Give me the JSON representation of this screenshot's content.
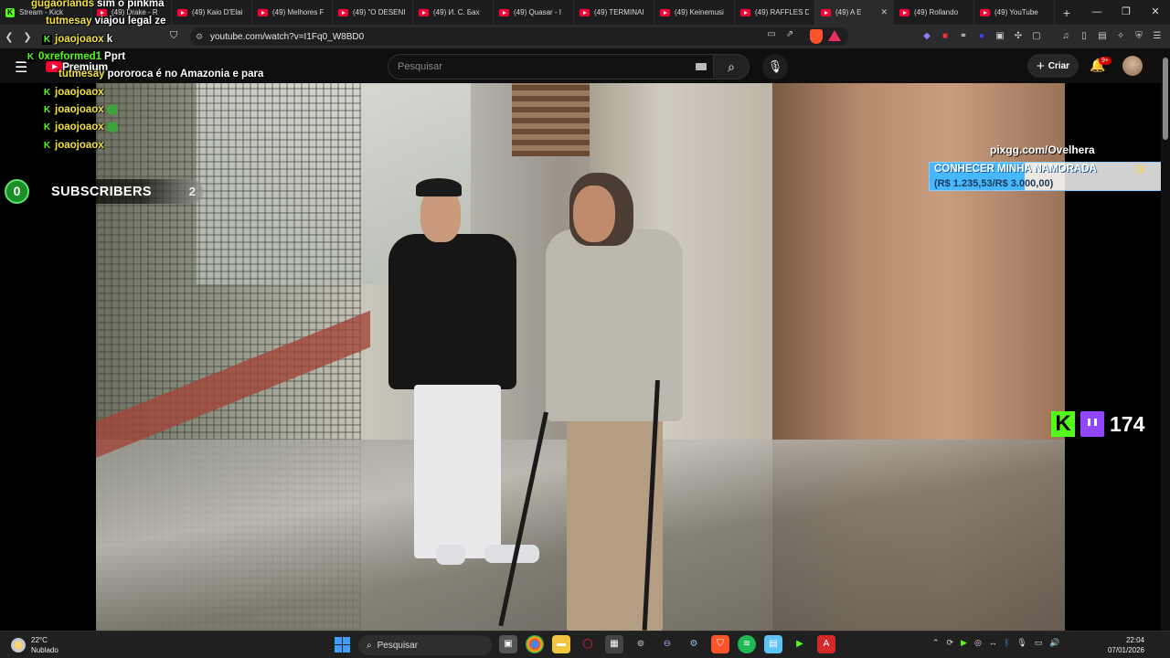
{
  "browser": {
    "tabs": [
      {
        "label": "Stream - Kick",
        "icon": "kick-icon",
        "active": false
      },
      {
        "label": "(49) Drake - R",
        "icon": "youtube-icon",
        "active": false
      },
      {
        "label": "(49) Kaio D'Elai",
        "icon": "youtube-icon",
        "active": false
      },
      {
        "label": "(49) Melhores F",
        "icon": "youtube-icon",
        "active": false
      },
      {
        "label": "(49) \"O DESENI",
        "icon": "youtube-icon",
        "active": false
      },
      {
        "label": "(49) И. С. Бах",
        "icon": "youtube-icon",
        "active": false
      },
      {
        "label": "(49) Quasar - I",
        "icon": "youtube-icon",
        "active": false
      },
      {
        "label": "(49) TERMINAI",
        "icon": "youtube-icon",
        "active": false
      },
      {
        "label": "(49) Keinemusi",
        "icon": "youtube-icon",
        "active": false
      },
      {
        "label": "(49) RAFFLES D",
        "icon": "youtube-icon",
        "active": false
      },
      {
        "label": "(49) A E",
        "icon": "youtube-icon",
        "active": true
      },
      {
        "label": "(49) Rollando",
        "icon": "youtube-icon",
        "active": false
      },
      {
        "label": "(49) YouTube",
        "icon": "youtube-icon",
        "active": false
      }
    ],
    "url": "youtube.com/watch?v=I1Fq0_W8BD0"
  },
  "youtube": {
    "logo_text": "Premium",
    "search_placeholder": "Pesquisar",
    "create_label": "Criar",
    "notifications_count": "9+"
  },
  "overlay": {
    "chat": [
      {
        "user": "gugaorlands",
        "message": "sim o pinkma",
        "user_color": "yellow"
      },
      {
        "user": "tutmesay",
        "message": "viajou legal ze",
        "user_color": "yellow"
      },
      {
        "user": "joaojoaox",
        "message": "k",
        "user_color": "yellow"
      },
      {
        "user": "0xreformed1",
        "message": "Pprt",
        "user_color": "green"
      },
      {
        "user": "tutmesay",
        "message": "pororoca é no Amazonia e para",
        "user_color": "yellow"
      },
      {
        "user": "joaojoaox",
        "message": "",
        "user_color": "yellow"
      },
      {
        "user": "joaojoaox",
        "message": "",
        "user_color": "yellow"
      },
      {
        "user": "joaojoaox",
        "message": "",
        "user_color": "yellow"
      },
      {
        "user": "joaojoaox",
        "message": "",
        "user_color": "yellow"
      }
    ],
    "subscribers": {
      "current": "0",
      "label": "SUBSCRIBERS",
      "goal": "2"
    },
    "pix": {
      "site": "pixgg.com/Ovelhera",
      "goal_title": "CONHECER MINHA NAMORADA",
      "goal_amount": "(R$ 1.235,53/R$ 3.000,00)",
      "progress": 0.41
    },
    "viewers": "174"
  },
  "taskbar": {
    "weather_temp": "22°C",
    "weather_desc": "Nublado",
    "search_label": "Pesquisar",
    "time": "22:04",
    "date": "07/01/2026"
  }
}
